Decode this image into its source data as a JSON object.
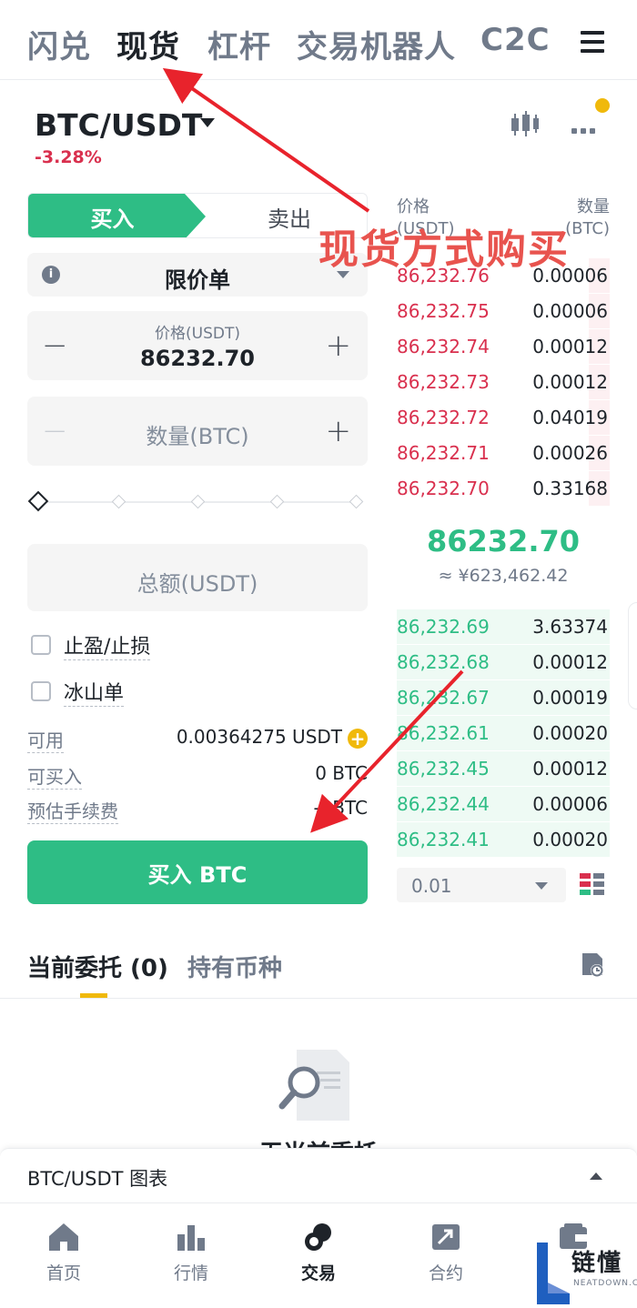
{
  "nav": {
    "tabs": [
      "闪兑",
      "现货",
      "杠杆",
      "交易机器人",
      "C2C"
    ],
    "active_tab": "现货"
  },
  "pair": {
    "symbol": "BTC/USDT",
    "change": "-3.28%"
  },
  "form": {
    "buy_label": "买入",
    "sell_label": "卖出",
    "order_type": "限价单",
    "price_label": "价格(USDT)",
    "price_value": "86232.70",
    "qty_placeholder": "数量(BTC)",
    "total_placeholder": "总额(USDT)",
    "take_profit_stop_loss": "止盈/止损",
    "iceberg": "冰山单",
    "available_label": "可用",
    "available_value": "0.00364275 USDT",
    "can_buy_label": "可买入",
    "can_buy_value": "0 BTC",
    "est_fee_label": "预估手续费",
    "est_fee_value": "-- BTC",
    "submit_label": "买入 BTC",
    "plus_symbol": "+",
    "minus_symbol": "−",
    "info_symbol": "i"
  },
  "orderbook": {
    "price_header": "价格",
    "price_unit": "(USDT)",
    "qty_header": "数量",
    "qty_unit": "(BTC)",
    "asks": [
      {
        "price": "86,232.76",
        "qty": "0.00006",
        "depth": 0.1
      },
      {
        "price": "86,232.75",
        "qty": "0.00006",
        "depth": 0.1
      },
      {
        "price": "86,232.74",
        "qty": "0.00012",
        "depth": 0.1
      },
      {
        "price": "86,232.73",
        "qty": "0.00012",
        "depth": 0.1
      },
      {
        "price": "86,232.72",
        "qty": "0.04019",
        "depth": 0.1
      },
      {
        "price": "86,232.71",
        "qty": "0.00026",
        "depth": 0.1
      },
      {
        "price": "86,232.70",
        "qty": "0.33168",
        "depth": 0.1
      }
    ],
    "mid_price": "86232.70",
    "mid_fiat": "≈ ¥623,462.42",
    "bids": [
      {
        "price": "86,232.69",
        "qty": "3.63374",
        "depth": 1.0
      },
      {
        "price": "86,232.68",
        "qty": "0.00012",
        "depth": 1.0
      },
      {
        "price": "86,232.67",
        "qty": "0.00019",
        "depth": 1.0
      },
      {
        "price": "86,232.61",
        "qty": "0.00020",
        "depth": 1.0
      },
      {
        "price": "86,232.45",
        "qty": "0.00012",
        "depth": 1.0
      },
      {
        "price": "86,232.44",
        "qty": "0.00006",
        "depth": 1.0
      },
      {
        "price": "86,232.41",
        "qty": "0.00020",
        "depth": 1.0
      }
    ],
    "depth_step": "0.01"
  },
  "orders": {
    "open_tab": "当前委托 (0)",
    "holdings_tab": "持有币种",
    "empty_text": "无当前委托"
  },
  "chart_bar": {
    "label": "BTC/USDT 图表"
  },
  "bottom_nav": [
    {
      "label": "首页",
      "icon": "home-icon"
    },
    {
      "label": "行情",
      "icon": "markets-icon"
    },
    {
      "label": "交易",
      "icon": "trade-icon"
    },
    {
      "label": "合约",
      "icon": "futures-icon"
    },
    {
      "label": "",
      "icon": "wallet-icon"
    }
  ],
  "annotation": {
    "text": "现货方式购买",
    "color": "#e8534e"
  },
  "watermark": {
    "brand": "链懂",
    "sub": "NEATDOWN.COM"
  },
  "colors": {
    "buy": "#2ebd85",
    "sell": "#d9304e",
    "accent": "#f0b90b"
  }
}
